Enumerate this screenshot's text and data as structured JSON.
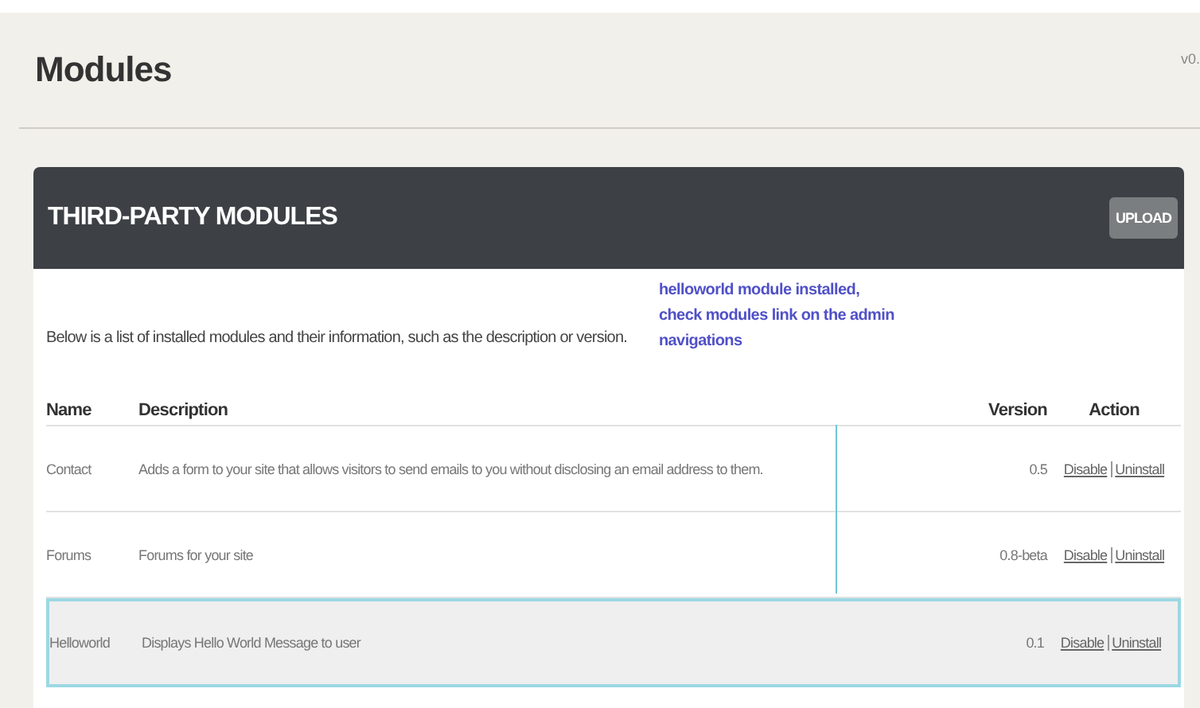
{
  "page": {
    "title": "Modules",
    "version": "v0."
  },
  "panel": {
    "title": "THIRD-PARTY MODULES",
    "upload_button": "UPLOAD",
    "intro": "Below is a list of installed modules and their information, such as the description or version.",
    "annotation": "helloworld module installed, check modules link on the admin navigations",
    "columns": [
      "Name",
      "Description",
      "Version",
      "Action"
    ],
    "rows": [
      {
        "name": "Contact",
        "description": "Adds a form to your site that allows visitors to send emails to you without disclosing an email address to them.",
        "version": "0.5",
        "actions": [
          "Disable",
          "Uninstall"
        ],
        "highlighted": false
      },
      {
        "name": "Forums",
        "description": "Forums for your site",
        "version": "0.8-beta",
        "actions": [
          "Disable",
          "Uninstall"
        ],
        "highlighted": false
      },
      {
        "name": "Helloworld",
        "description": "Displays Hello World Message to user",
        "version": "0.1",
        "actions": [
          "Disable",
          "Uninstall"
        ],
        "highlighted": true
      }
    ]
  }
}
